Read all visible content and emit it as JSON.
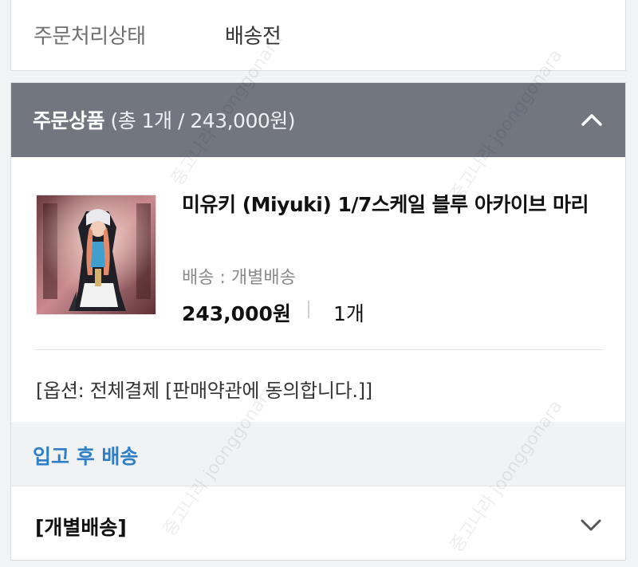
{
  "order_status": {
    "label": "주문처리상태",
    "value": "배송전"
  },
  "order_items": {
    "title": "주문상품",
    "summary": "(총 1개 / 243,000원)",
    "toggle_icon": "chevron-up-icon"
  },
  "product": {
    "name": "미유키 (Miyuki) 1/7스케일 블루 아카이브 마리",
    "shipping": "배송 : 개별배송",
    "price": "243,000원",
    "quantity": "1개",
    "option": "[옵션: 전체결제 [판매약관에 동의합니다.]]"
  },
  "shipping_note": {
    "text": "입고 후 배송"
  },
  "shipping_detail": {
    "label": "[개별배송]",
    "toggle_icon": "chevron-down-icon"
  },
  "colors": {
    "header_bg": "#72767f",
    "link_blue": "#2e7ec8",
    "page_bg": "#f2f3f5"
  },
  "watermark": {
    "text": "중고나라 joonggonara"
  }
}
